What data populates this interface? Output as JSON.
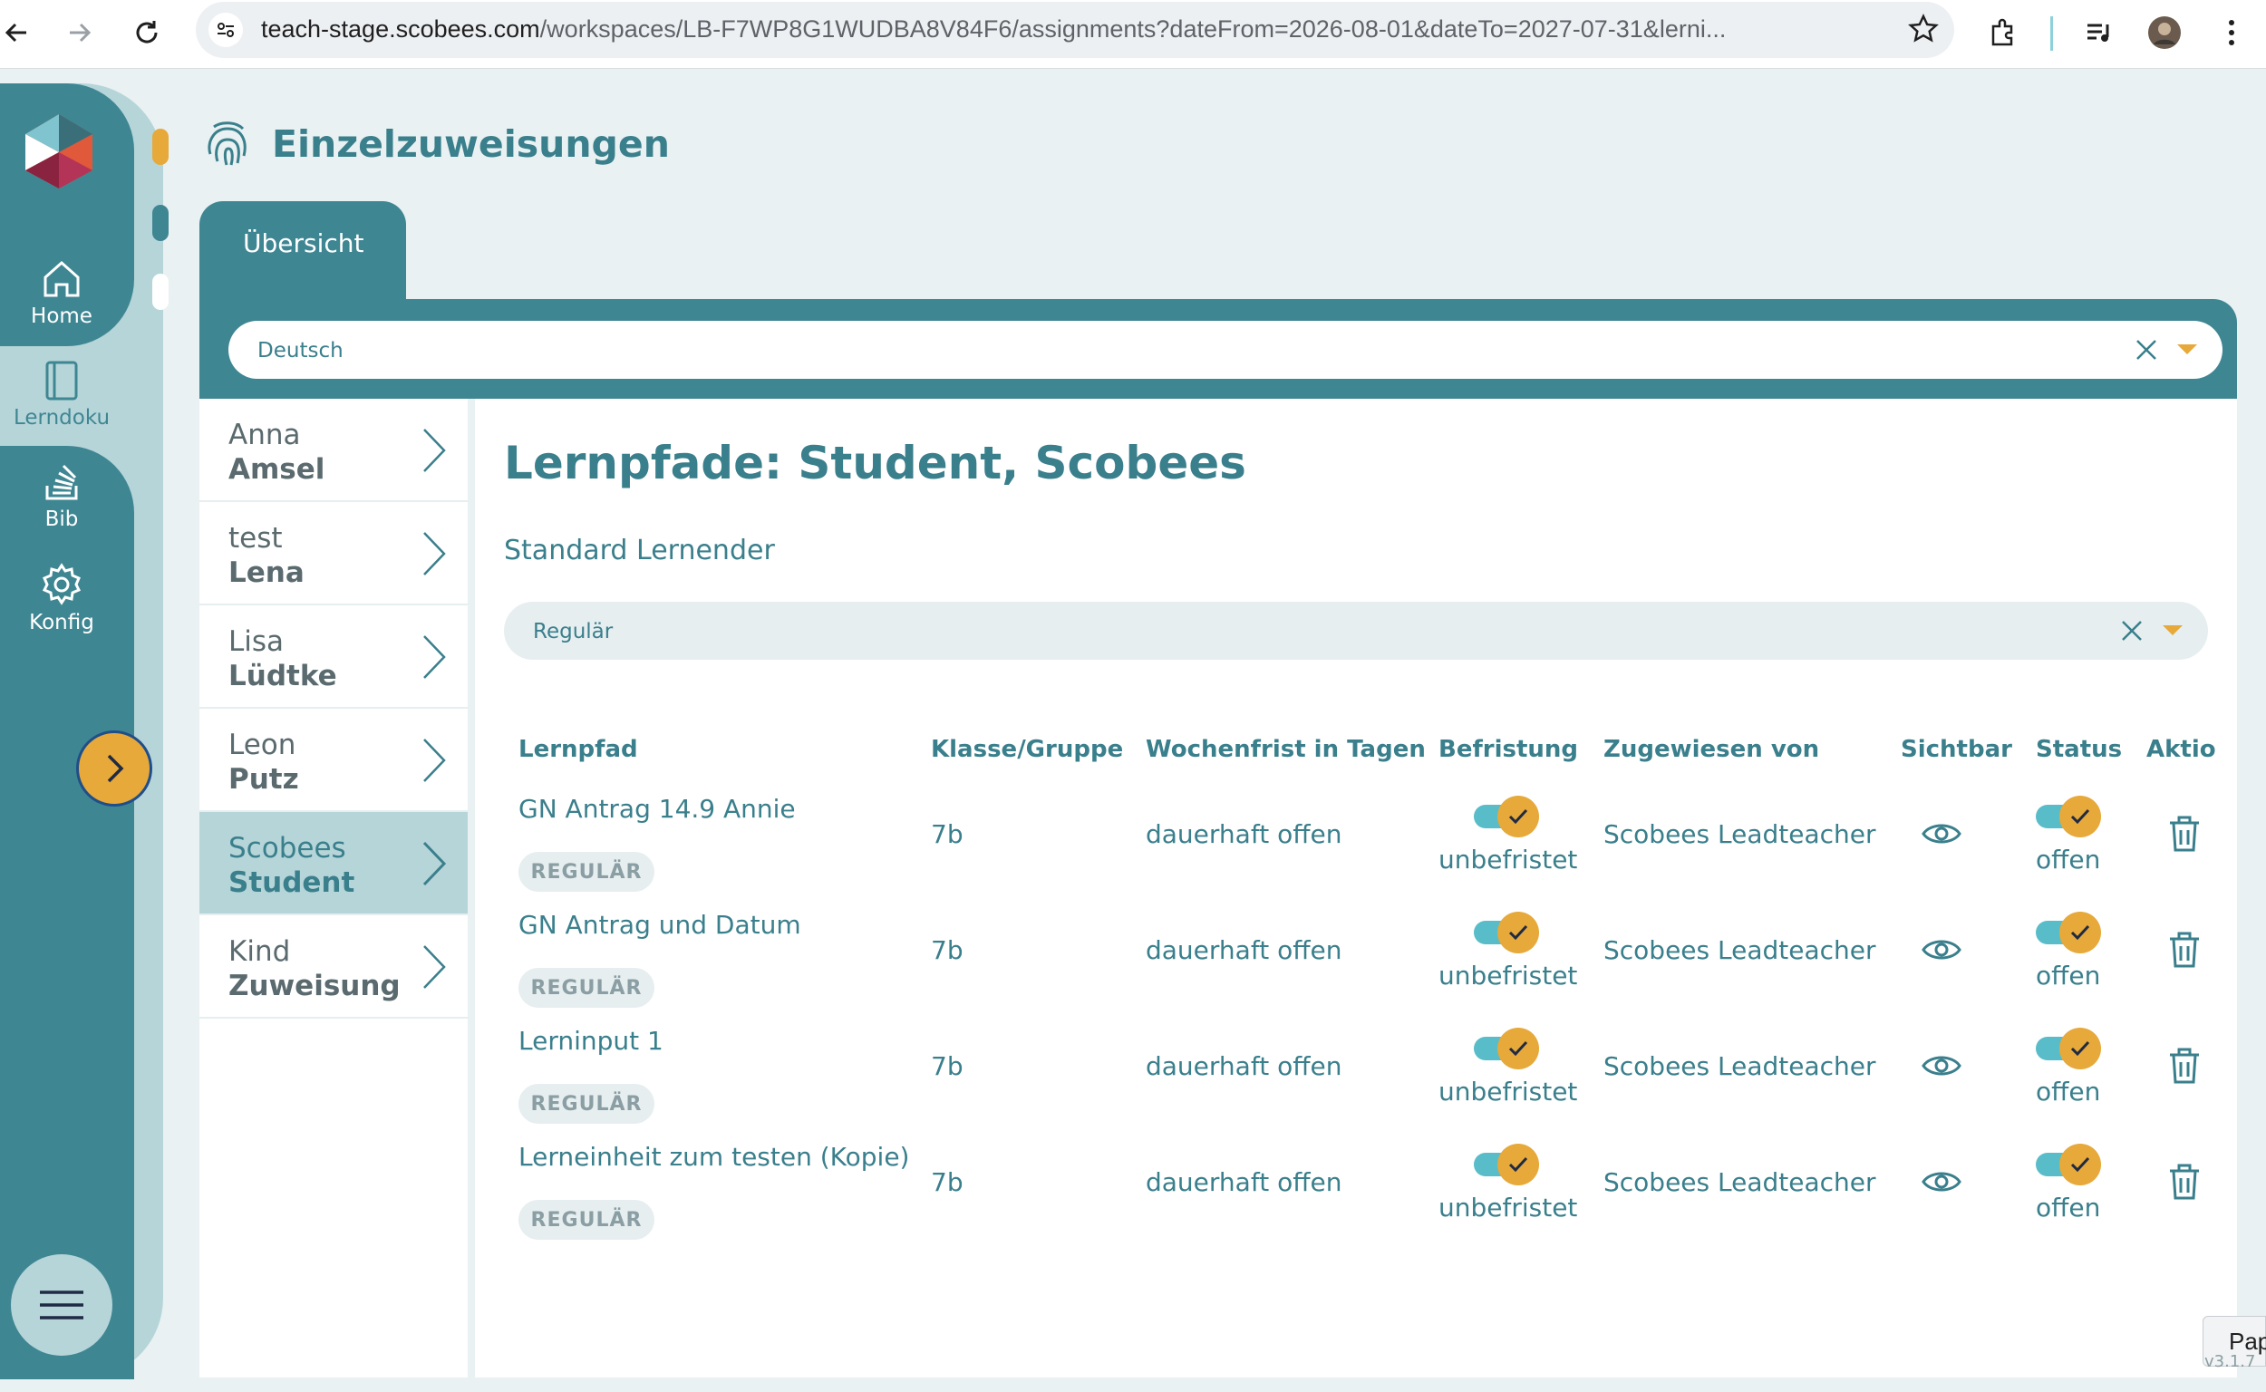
{
  "browser": {
    "url_host": "teach-stage.scobees.com",
    "url_path": "/workspaces/LB-F7WP8G1WUDBA8V84F6/assignments?dateFrom=2026-08-01&dateTo=2027-07-31&lerni..."
  },
  "rail": {
    "items": [
      {
        "label": "Home",
        "icon": "home-icon"
      },
      {
        "label": "Lerndoku",
        "icon": "book-icon"
      },
      {
        "label": "Bib",
        "icon": "library-icon"
      },
      {
        "label": "Konfig",
        "icon": "gear-icon"
      }
    ],
    "active": "Lerndoku",
    "accent": "#e6a93a",
    "brand": "#3f8693"
  },
  "header": {
    "title": "Einzelzuweisungen",
    "icon": "fingerprint-icon"
  },
  "tabs": [
    {
      "label": "Übersicht"
    }
  ],
  "subject_filter": {
    "value": "Deutsch"
  },
  "students": [
    {
      "first": "Anna",
      "last": "Amsel"
    },
    {
      "first": "test",
      "last": "Lena"
    },
    {
      "first": "Lisa",
      "last": "Lüdtke"
    },
    {
      "first": "Leon",
      "last": "Putz"
    },
    {
      "first": "Scobees",
      "last": "Student",
      "selected": true
    },
    {
      "first": "Kind",
      "last": "Zuweisung"
    }
  ],
  "main": {
    "title": "Lernpfade: Student, Scobees",
    "subtitle": "Standard Lernender",
    "type_filter": "Regulär"
  },
  "table": {
    "headers": [
      "Lernpfad",
      "Klasse/Gruppe",
      "Wochenfrist in Tagen",
      "Befristung",
      "Zugewiesen von",
      "Sichtbar",
      "Status",
      "Aktio"
    ],
    "rows": [
      {
        "lernpfad": "GN Antrag 14.9 Annie",
        "badge": "REGULÄR",
        "klasse": "7b",
        "wochenfrist": "dauerhaft offen",
        "befristung": "unbefristet",
        "zugewiesen": "Scobees Leadteacher",
        "status": "offen"
      },
      {
        "lernpfad": "GN Antrag und Datum",
        "badge": "REGULÄR",
        "klasse": "7b",
        "wochenfrist": "dauerhaft offen",
        "befristung": "unbefristet",
        "zugewiesen": "Scobees Leadteacher",
        "status": "offen"
      },
      {
        "lernpfad": "Lerninput 1",
        "badge": "REGULÄR",
        "klasse": "7b",
        "wochenfrist": "dauerhaft offen",
        "befristung": "unbefristet",
        "zugewiesen": "Scobees Leadteacher",
        "status": "offen"
      },
      {
        "lernpfad": "Lerneinheit zum testen (Kopie)",
        "badge": "REGULÄR",
        "klasse": "7b",
        "wochenfrist": "dauerhaft offen",
        "befristung": "unbefristet",
        "zugewiesen": "Scobees Leadteacher",
        "status": "offen"
      }
    ]
  },
  "footer": {
    "paper_label": "Pap",
    "version": "v3.1.7"
  }
}
